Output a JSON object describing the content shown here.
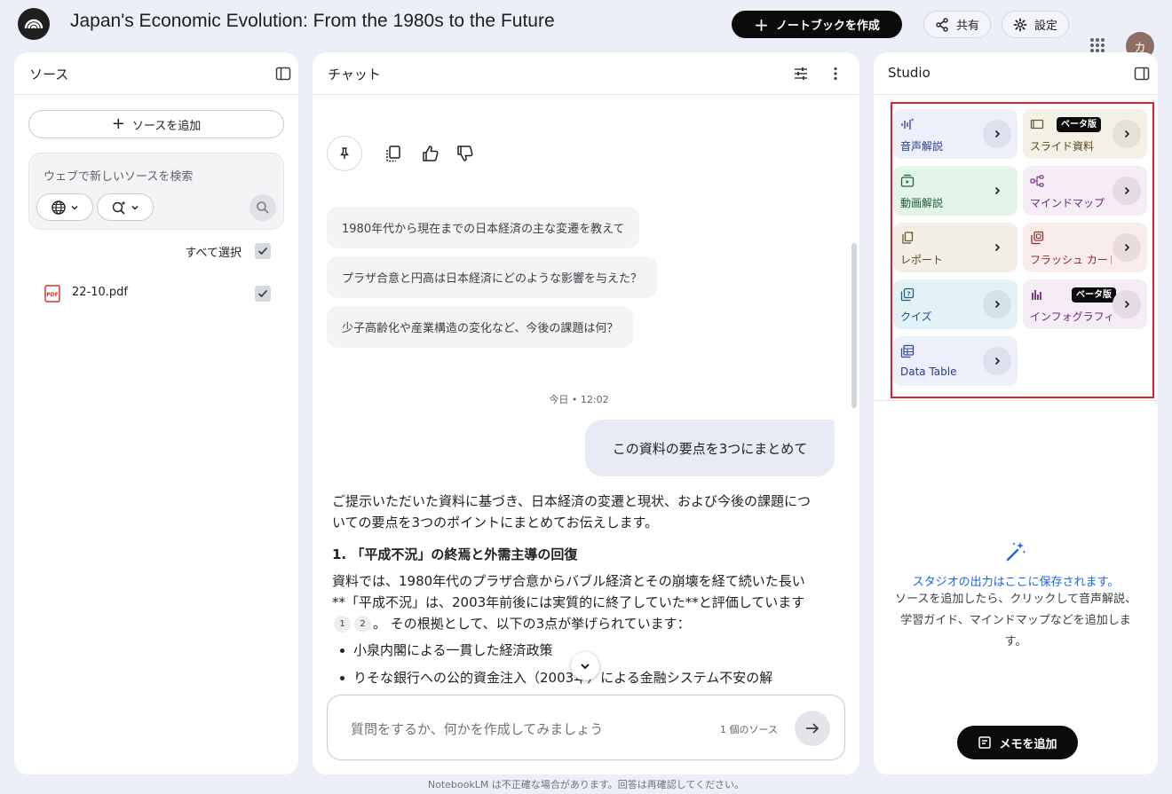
{
  "header": {
    "title": "Japan's Economic Evolution: From the 1980s to the Future",
    "create_notebook": "ノートブックを作成",
    "share": "共有",
    "settings": "設定",
    "avatar_letter": "カ"
  },
  "sources": {
    "title": "ソース",
    "add_source": "ソースを追加",
    "search_placeholder": "ウェブで新しいソースを検索",
    "select_all": "すべて選択",
    "files": [
      {
        "name": "22-10.pdf",
        "checked": true
      }
    ]
  },
  "chat": {
    "title": "チャット",
    "suggestions": [
      "1980年代から現在までの日本経済の主な変遷を教えて",
      "プラザ合意と円高は日本経済にどのような影響を与えた？",
      "少子高齢化や産業構造の変化など、今後の課題は何？"
    ],
    "timestamp": "今日 • 12:02",
    "user_message": "この資料の要点を3つにまとめて",
    "answer_intro": "ご提示いただいた資料に基づき、日本経済の変遷と現状、および今後の課題についての要点を3つのポイントにまとめてお伝えします。",
    "answer_heading": "1. 「平成不況」の終焉と外需主導の回復",
    "answer_para_a": "資料では、1980年代のプラザ合意からバブル経済とその崩壊を経て続いた長い**「平成不況」は、2003年前後には実質的に終了していた**と評価しています",
    "cite_1": "1",
    "cite_2": "2",
    "answer_para_b": "。 その根拠として、以下の3点が挙げられています：",
    "bullets": [
      "小泉内閣による一貫した経済政策",
      "りそな銀行への公的資金注入（2003年）による金融システム不安の解"
    ],
    "input_placeholder": "質問をするか、何かを作成してみましょう",
    "source_count": "1 個のソース"
  },
  "studio": {
    "title": "Studio",
    "beta_label": "ベータ版",
    "tiles": {
      "audio": "音声解説",
      "slides": "スライド資料",
      "video": "動画解説",
      "mindmap": "マインドマップ",
      "report": "レポート",
      "flashcards": "フラッシュ カード",
      "quiz": "クイズ",
      "infographic": "インフォグラフィック",
      "datatable": "Data Table"
    },
    "empty_title": "スタジオの出力はここに保存されます。",
    "empty_desc": "ソースを追加したら、クリックして音声解説、学習ガイド、マインドマップなどを追加します。",
    "add_memo": "メモを追加"
  },
  "footer": "NotebookLM は不正確な場合があります。回答は再確認してください。",
  "colors": {
    "background": "#eceff8",
    "accent_blue": "#1a66e8",
    "highlight_red": "#e0202a",
    "tile_blue": "#edf0fb",
    "tile_beige": "#f3f0e6",
    "tile_green": "#e3f4e8",
    "tile_purple": "#f5ecf6",
    "tile_cream": "#f3efe6",
    "tile_pink": "#f9ecec",
    "tile_cyan": "#e3f2f7"
  }
}
